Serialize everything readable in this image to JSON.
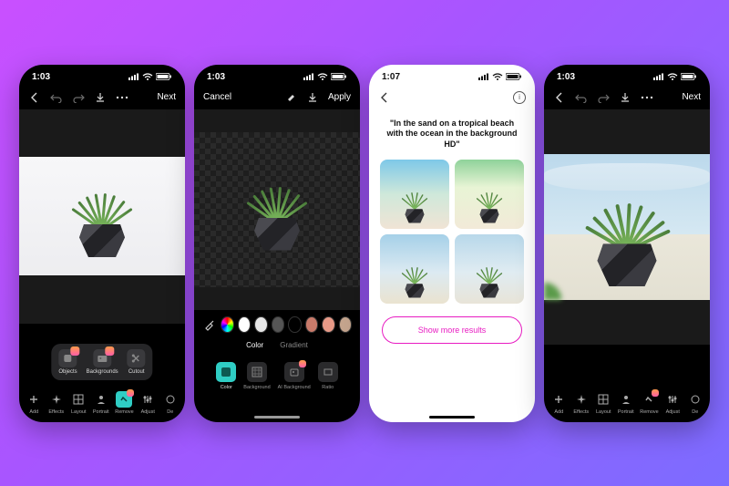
{
  "phones": [
    {
      "time": "1:03",
      "header": {
        "next": "Next"
      },
      "popover": [
        {
          "label": "Objects",
          "badge": true
        },
        {
          "label": "Backgrounds",
          "badge": true
        },
        {
          "label": "Cutout",
          "badge": false
        }
      ],
      "toolbar": [
        {
          "label": "Add"
        },
        {
          "label": "Effects"
        },
        {
          "label": "Layout"
        },
        {
          "label": "Portrait"
        },
        {
          "label": "Remove",
          "active": true,
          "badge": true
        },
        {
          "label": "Adjust"
        },
        {
          "label": "De"
        }
      ]
    },
    {
      "time": "1:03",
      "header": {
        "cancel": "Cancel",
        "apply": "Apply"
      },
      "swatch_colors": [
        "spectrum",
        "#ffffff",
        "#e5e5e5",
        "#555555",
        "#000000",
        "#c97a6a",
        "#e89a88",
        "#c5a58e"
      ],
      "color_tabs": {
        "a": "Color",
        "b": "Gradient"
      },
      "sub_tools": [
        {
          "label": "Color",
          "active": true
        },
        {
          "label": "Background"
        },
        {
          "label": "AI Background",
          "badge": true
        },
        {
          "label": "Ratio"
        }
      ]
    },
    {
      "time": "1:07",
      "prompt": "\"In the sand on a tropical beach with the ocean in the background HD\"",
      "show_more": "Show more results"
    },
    {
      "time": "1:03",
      "header": {
        "next": "Next"
      },
      "toolbar": [
        {
          "label": "Add"
        },
        {
          "label": "Effects"
        },
        {
          "label": "Layout"
        },
        {
          "label": "Portrait"
        },
        {
          "label": "Remove",
          "badge": true
        },
        {
          "label": "Adjust"
        },
        {
          "label": "De"
        }
      ]
    }
  ]
}
